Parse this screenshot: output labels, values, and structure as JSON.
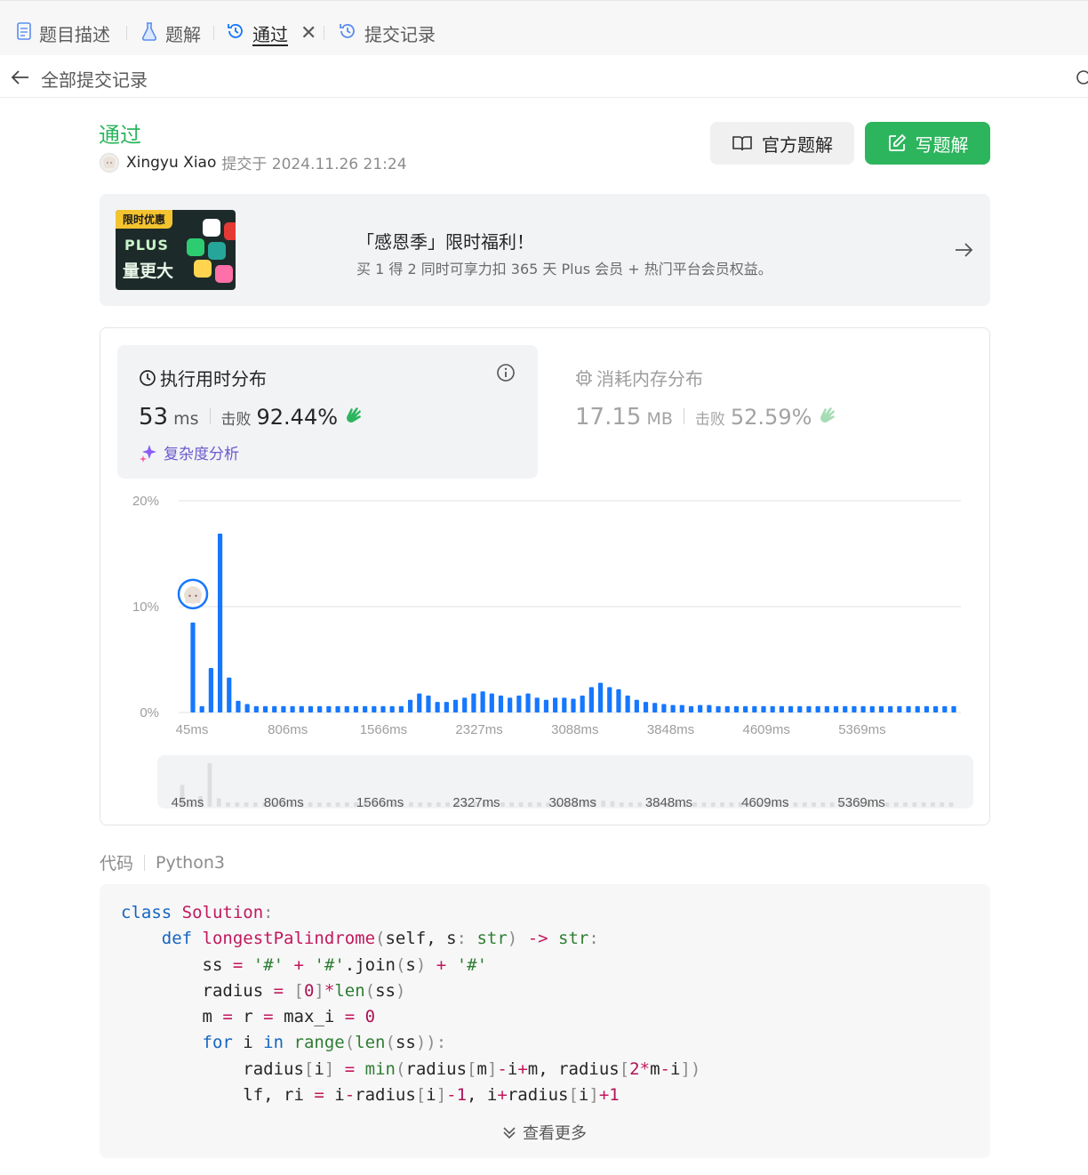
{
  "tabs": [
    {
      "label": "题目描述",
      "icon": "document-icon"
    },
    {
      "label": "题解",
      "icon": "flask-icon"
    },
    {
      "label": "通过",
      "icon": "history-icon",
      "active": true
    },
    {
      "label": "提交记录",
      "icon": "history-icon"
    }
  ],
  "subbar": {
    "title": "全部提交记录"
  },
  "submission": {
    "status": "通过",
    "user": "Xingyu Xiao",
    "submitted_text": "提交于 2024.11.26 21:24"
  },
  "buttons": {
    "official_solution": "官方题解",
    "write_solution": "写题解"
  },
  "promo": {
    "tag": "限时优惠",
    "plus": "PLUS",
    "big": "量更大",
    "title": "「感恩季」限时福利！",
    "desc": "买 1 得 2 同时可享力扣 365 天 Plus 会员 + 热门平台会员权益。"
  },
  "runtime": {
    "title": "执行用时分布",
    "value": "53",
    "unit": "ms",
    "beat_label": "击败",
    "beat": "92.44%",
    "complexity": "复杂度分析"
  },
  "memory": {
    "title": "消耗内存分布",
    "value": "17.15",
    "unit": "MB",
    "beat_label": "击败",
    "beat": "52.59%"
  },
  "chart_data": {
    "type": "bar",
    "ylabel_ticks": [
      "0%",
      "10%",
      "20%"
    ],
    "ylim": [
      0,
      20
    ],
    "x_ticks": [
      "45ms",
      "806ms",
      "1566ms",
      "2327ms",
      "3088ms",
      "3848ms",
      "4609ms",
      "5369ms"
    ],
    "highlight_index": 0,
    "values": [
      8.5,
      0.6,
      4.2,
      16.9,
      3.3,
      1.1,
      0.8,
      0.6,
      0.6,
      0.6,
      0.6,
      0.6,
      0.6,
      0.6,
      0.6,
      0.6,
      0.6,
      0.6,
      0.6,
      0.6,
      0.6,
      0.6,
      0.6,
      0.6,
      1.2,
      1.8,
      1.6,
      1.0,
      1.0,
      1.2,
      1.4,
      1.8,
      2.0,
      1.8,
      1.6,
      1.4,
      1.6,
      1.8,
      1.4,
      1.2,
      1.4,
      1.4,
      1.3,
      1.6,
      2.4,
      2.8,
      2.4,
      2.2,
      1.6,
      1.2,
      1.0,
      0.9,
      0.8,
      0.7,
      0.7,
      0.6,
      0.7,
      0.7,
      0.6,
      0.6,
      0.6,
      0.6,
      0.6,
      0.6,
      0.6,
      0.6,
      0.6,
      0.6,
      0.6,
      0.6,
      0.6,
      0.6,
      0.6,
      0.6,
      0.6,
      0.6,
      0.6,
      0.6,
      0.6,
      0.6,
      0.6,
      0.6,
      0.6,
      0.6,
      0.6
    ]
  },
  "code": {
    "header_label": "代码",
    "language": "Python3",
    "more": "查看更多"
  },
  "colors": {
    "accent_green": "#2db55d",
    "bar_blue": "#1677ff"
  }
}
